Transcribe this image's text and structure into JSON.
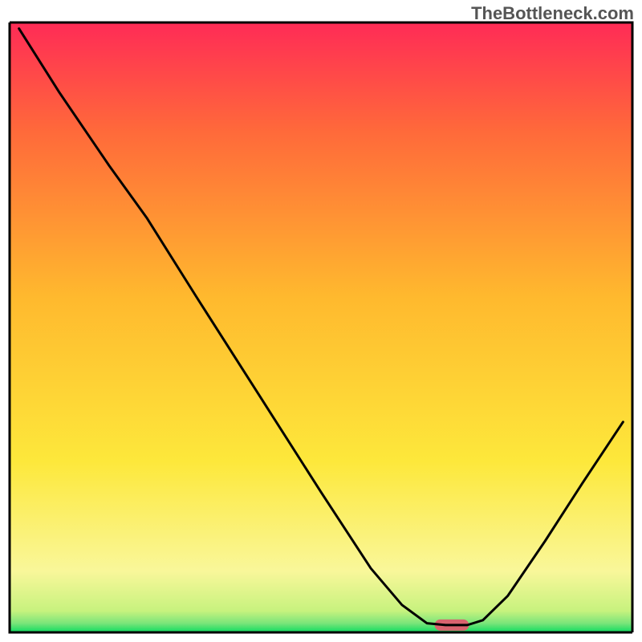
{
  "watermark": "TheBottleneck.com",
  "chart_data": {
    "type": "line",
    "title": "",
    "xlabel": "",
    "ylabel": "",
    "xlim": [
      0,
      100
    ],
    "ylim": [
      0,
      100
    ],
    "background_gradient": {
      "top": "#ff2b56",
      "mid_upper": "#ff6a3a",
      "mid": "#ffb92e",
      "mid_lower": "#fde83b",
      "lower": "#f9f79a",
      "bottom": "#0ddb5f"
    },
    "curve": [
      {
        "x": 1.5,
        "y": 99.0
      },
      {
        "x": 8.0,
        "y": 88.5
      },
      {
        "x": 16.0,
        "y": 76.5
      },
      {
        "x": 22.0,
        "y": 68.0
      },
      {
        "x": 30.0,
        "y": 55.0
      },
      {
        "x": 40.0,
        "y": 39.0
      },
      {
        "x": 50.0,
        "y": 23.0
      },
      {
        "x": 58.0,
        "y": 10.5
      },
      {
        "x": 63.0,
        "y": 4.5
      },
      {
        "x": 67.0,
        "y": 1.5
      },
      {
        "x": 70.0,
        "y": 1.2
      },
      {
        "x": 73.5,
        "y": 1.2
      },
      {
        "x": 76.0,
        "y": 2.0
      },
      {
        "x": 80.0,
        "y": 6.0
      },
      {
        "x": 86.0,
        "y": 15.0
      },
      {
        "x": 92.0,
        "y": 24.5
      },
      {
        "x": 98.5,
        "y": 34.5
      }
    ],
    "marker": {
      "x": 71.0,
      "y": 1.2,
      "width": 5.5,
      "color": "#d9636e"
    },
    "baseline_y": 1.2,
    "frame_color": "#000000",
    "line_color": "#000000",
    "line_width": 3
  }
}
